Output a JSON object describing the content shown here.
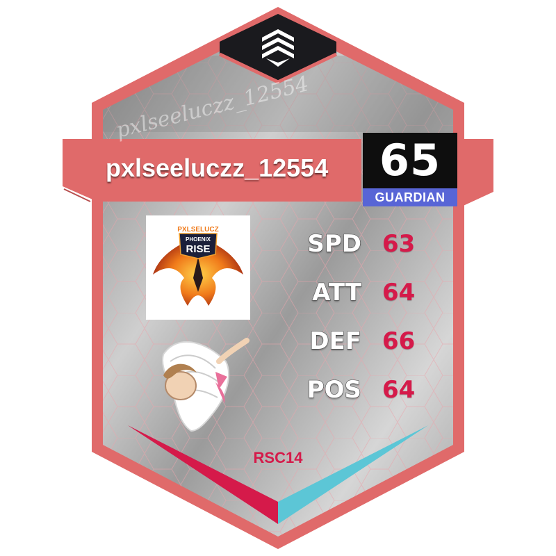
{
  "player": {
    "name": "pxlseeluczz_12554",
    "signature": "pxlseeluczz_12554",
    "overall": "65",
    "role": "GUARDIAN",
    "team_logo": {
      "lines": [
        "PXLSELUCZ",
        "PHOENIX",
        "RISE"
      ],
      "icon": "phoenix-logo"
    },
    "avatar_icon": "winged-figure"
  },
  "stats": [
    {
      "label": "SPD",
      "value": "63"
    },
    {
      "label": "ATT",
      "value": "64"
    },
    {
      "label": "DEF",
      "value": "66"
    },
    {
      "label": "POS",
      "value": "64"
    }
  ],
  "season": "RSC14",
  "brand_icon": "layered-chevron-logo",
  "colors": {
    "frame": "#e06a6a",
    "banner": "#e06a6a",
    "overall_bg": "#0e0e0e",
    "role_bg": "#5865d6",
    "stat_value": "#d51a4a",
    "accent_left": "#d51a4a",
    "accent_right": "#5cc6d6",
    "hex_lines": "#e9a3ab"
  }
}
